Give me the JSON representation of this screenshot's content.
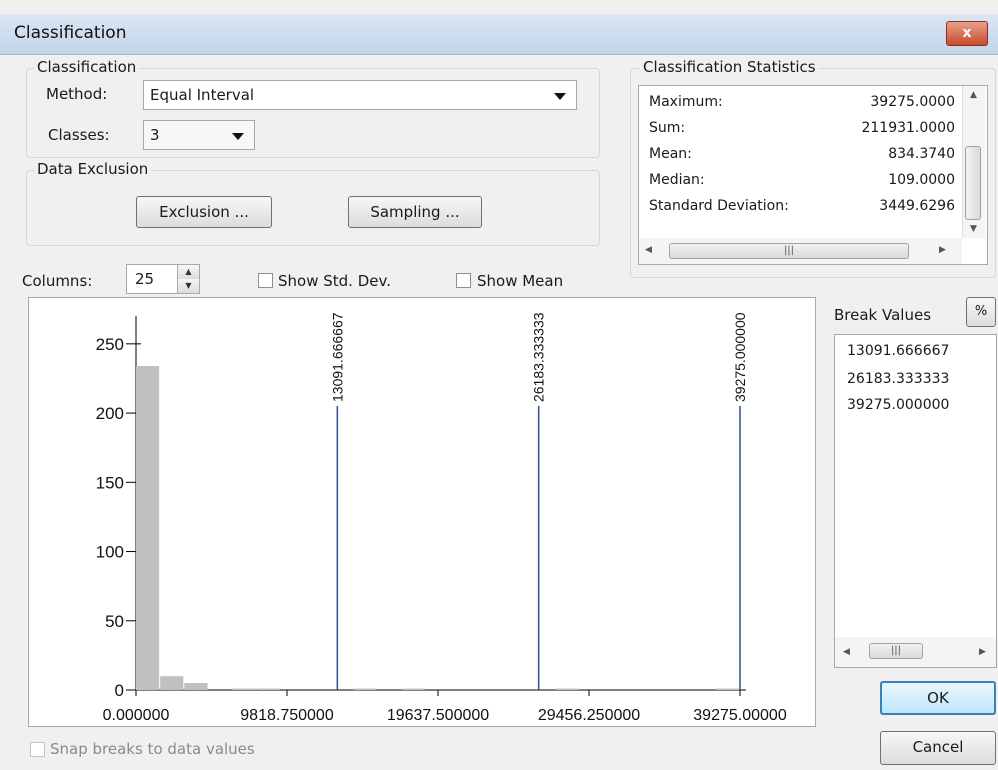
{
  "window": {
    "title": "Classification",
    "close_label": "x"
  },
  "classification": {
    "group_label": "Classification",
    "method_label": "Method:",
    "method_value": "Equal Interval",
    "classes_label": "Classes:",
    "classes_value": "3"
  },
  "data_exclusion": {
    "group_label": "Data Exclusion",
    "exclusion_button": "Exclusion ...",
    "sampling_button": "Sampling ..."
  },
  "statistics": {
    "title": "Classification Statistics",
    "rows": [
      {
        "label": "Maximum:",
        "value": "39275.0000"
      },
      {
        "label": "Sum:",
        "value": "211931.0000"
      },
      {
        "label": "Mean:",
        "value": "834.3740"
      },
      {
        "label": "Median:",
        "value": "109.0000"
      },
      {
        "label": "Standard Deviation:",
        "value": "3449.6296"
      }
    ]
  },
  "options": {
    "columns_label": "Columns:",
    "columns_value": "25",
    "show_std_dev": "Show Std. Dev.",
    "show_mean": "Show Mean",
    "snap_breaks": "Snap breaks to data values"
  },
  "break_values": {
    "title": "Break Values",
    "percent_button": "%",
    "items": [
      "13091.666667",
      "26183.333333",
      "39275.000000"
    ]
  },
  "buttons": {
    "ok": "OK",
    "cancel": "Cancel"
  },
  "chart_data": {
    "type": "bar",
    "title": "",
    "xlabel": "",
    "ylabel": "",
    "xlim": [
      0,
      39275
    ],
    "ylim": [
      0,
      260
    ],
    "y_ticks": [
      0,
      50,
      100,
      150,
      200,
      250
    ],
    "x_tick_labels": [
      "0.000000",
      "9818.750000",
      "19637.500000",
      "29456.250000",
      "39275.00000"
    ],
    "x_tick_values": [
      0,
      9818.75,
      19637.5,
      29456.25,
      39275
    ],
    "bin_width": 1571,
    "bins": [
      {
        "x": 0,
        "count": 234
      },
      {
        "x": 1571,
        "count": 10
      },
      {
        "x": 3142,
        "count": 5
      },
      {
        "x": 6284,
        "count": 1
      },
      {
        "x": 7855,
        "count": 1
      },
      {
        "x": 14139,
        "count": 1
      },
      {
        "x": 17281,
        "count": 1
      },
      {
        "x": 27276,
        "count": 1
      },
      {
        "x": 37705,
        "count": 1
      }
    ],
    "break_lines": [
      {
        "value": 13091.666667,
        "label": "13091.666667"
      },
      {
        "value": 26183.333333,
        "label": "26183.333333"
      },
      {
        "value": 39275.0,
        "label": "39275.000000"
      }
    ],
    "colors": {
      "bars": "#c0c0c0",
      "breaks": "#2f4f8f"
    }
  }
}
